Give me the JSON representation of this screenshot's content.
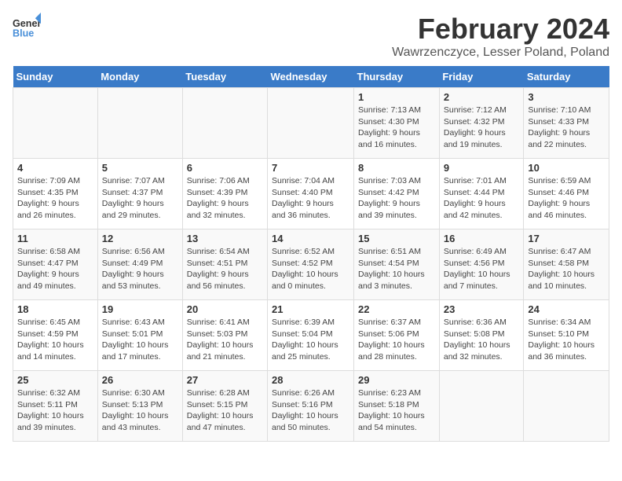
{
  "header": {
    "logo_line1": "General",
    "logo_line2": "Blue",
    "title": "February 2024",
    "subtitle": "Wawrzenczyce, Lesser Poland, Poland"
  },
  "weekdays": [
    "Sunday",
    "Monday",
    "Tuesday",
    "Wednesday",
    "Thursday",
    "Friday",
    "Saturday"
  ],
  "weeks": [
    [
      {
        "day": "",
        "info": ""
      },
      {
        "day": "",
        "info": ""
      },
      {
        "day": "",
        "info": ""
      },
      {
        "day": "",
        "info": ""
      },
      {
        "day": "1",
        "info": "Sunrise: 7:13 AM\nSunset: 4:30 PM\nDaylight: 9 hours and 16 minutes."
      },
      {
        "day": "2",
        "info": "Sunrise: 7:12 AM\nSunset: 4:32 PM\nDaylight: 9 hours and 19 minutes."
      },
      {
        "day": "3",
        "info": "Sunrise: 7:10 AM\nSunset: 4:33 PM\nDaylight: 9 hours and 22 minutes."
      }
    ],
    [
      {
        "day": "4",
        "info": "Sunrise: 7:09 AM\nSunset: 4:35 PM\nDaylight: 9 hours and 26 minutes."
      },
      {
        "day": "5",
        "info": "Sunrise: 7:07 AM\nSunset: 4:37 PM\nDaylight: 9 hours and 29 minutes."
      },
      {
        "day": "6",
        "info": "Sunrise: 7:06 AM\nSunset: 4:39 PM\nDaylight: 9 hours and 32 minutes."
      },
      {
        "day": "7",
        "info": "Sunrise: 7:04 AM\nSunset: 4:40 PM\nDaylight: 9 hours and 36 minutes."
      },
      {
        "day": "8",
        "info": "Sunrise: 7:03 AM\nSunset: 4:42 PM\nDaylight: 9 hours and 39 minutes."
      },
      {
        "day": "9",
        "info": "Sunrise: 7:01 AM\nSunset: 4:44 PM\nDaylight: 9 hours and 42 minutes."
      },
      {
        "day": "10",
        "info": "Sunrise: 6:59 AM\nSunset: 4:46 PM\nDaylight: 9 hours and 46 minutes."
      }
    ],
    [
      {
        "day": "11",
        "info": "Sunrise: 6:58 AM\nSunset: 4:47 PM\nDaylight: 9 hours and 49 minutes."
      },
      {
        "day": "12",
        "info": "Sunrise: 6:56 AM\nSunset: 4:49 PM\nDaylight: 9 hours and 53 minutes."
      },
      {
        "day": "13",
        "info": "Sunrise: 6:54 AM\nSunset: 4:51 PM\nDaylight: 9 hours and 56 minutes."
      },
      {
        "day": "14",
        "info": "Sunrise: 6:52 AM\nSunset: 4:52 PM\nDaylight: 10 hours and 0 minutes."
      },
      {
        "day": "15",
        "info": "Sunrise: 6:51 AM\nSunset: 4:54 PM\nDaylight: 10 hours and 3 minutes."
      },
      {
        "day": "16",
        "info": "Sunrise: 6:49 AM\nSunset: 4:56 PM\nDaylight: 10 hours and 7 minutes."
      },
      {
        "day": "17",
        "info": "Sunrise: 6:47 AM\nSunset: 4:58 PM\nDaylight: 10 hours and 10 minutes."
      }
    ],
    [
      {
        "day": "18",
        "info": "Sunrise: 6:45 AM\nSunset: 4:59 PM\nDaylight: 10 hours and 14 minutes."
      },
      {
        "day": "19",
        "info": "Sunrise: 6:43 AM\nSunset: 5:01 PM\nDaylight: 10 hours and 17 minutes."
      },
      {
        "day": "20",
        "info": "Sunrise: 6:41 AM\nSunset: 5:03 PM\nDaylight: 10 hours and 21 minutes."
      },
      {
        "day": "21",
        "info": "Sunrise: 6:39 AM\nSunset: 5:04 PM\nDaylight: 10 hours and 25 minutes."
      },
      {
        "day": "22",
        "info": "Sunrise: 6:37 AM\nSunset: 5:06 PM\nDaylight: 10 hours and 28 minutes."
      },
      {
        "day": "23",
        "info": "Sunrise: 6:36 AM\nSunset: 5:08 PM\nDaylight: 10 hours and 32 minutes."
      },
      {
        "day": "24",
        "info": "Sunrise: 6:34 AM\nSunset: 5:10 PM\nDaylight: 10 hours and 36 minutes."
      }
    ],
    [
      {
        "day": "25",
        "info": "Sunrise: 6:32 AM\nSunset: 5:11 PM\nDaylight: 10 hours and 39 minutes."
      },
      {
        "day": "26",
        "info": "Sunrise: 6:30 AM\nSunset: 5:13 PM\nDaylight: 10 hours and 43 minutes."
      },
      {
        "day": "27",
        "info": "Sunrise: 6:28 AM\nSunset: 5:15 PM\nDaylight: 10 hours and 47 minutes."
      },
      {
        "day": "28",
        "info": "Sunrise: 6:26 AM\nSunset: 5:16 PM\nDaylight: 10 hours and 50 minutes."
      },
      {
        "day": "29",
        "info": "Sunrise: 6:23 AM\nSunset: 5:18 PM\nDaylight: 10 hours and 54 minutes."
      },
      {
        "day": "",
        "info": ""
      },
      {
        "day": "",
        "info": ""
      }
    ]
  ]
}
